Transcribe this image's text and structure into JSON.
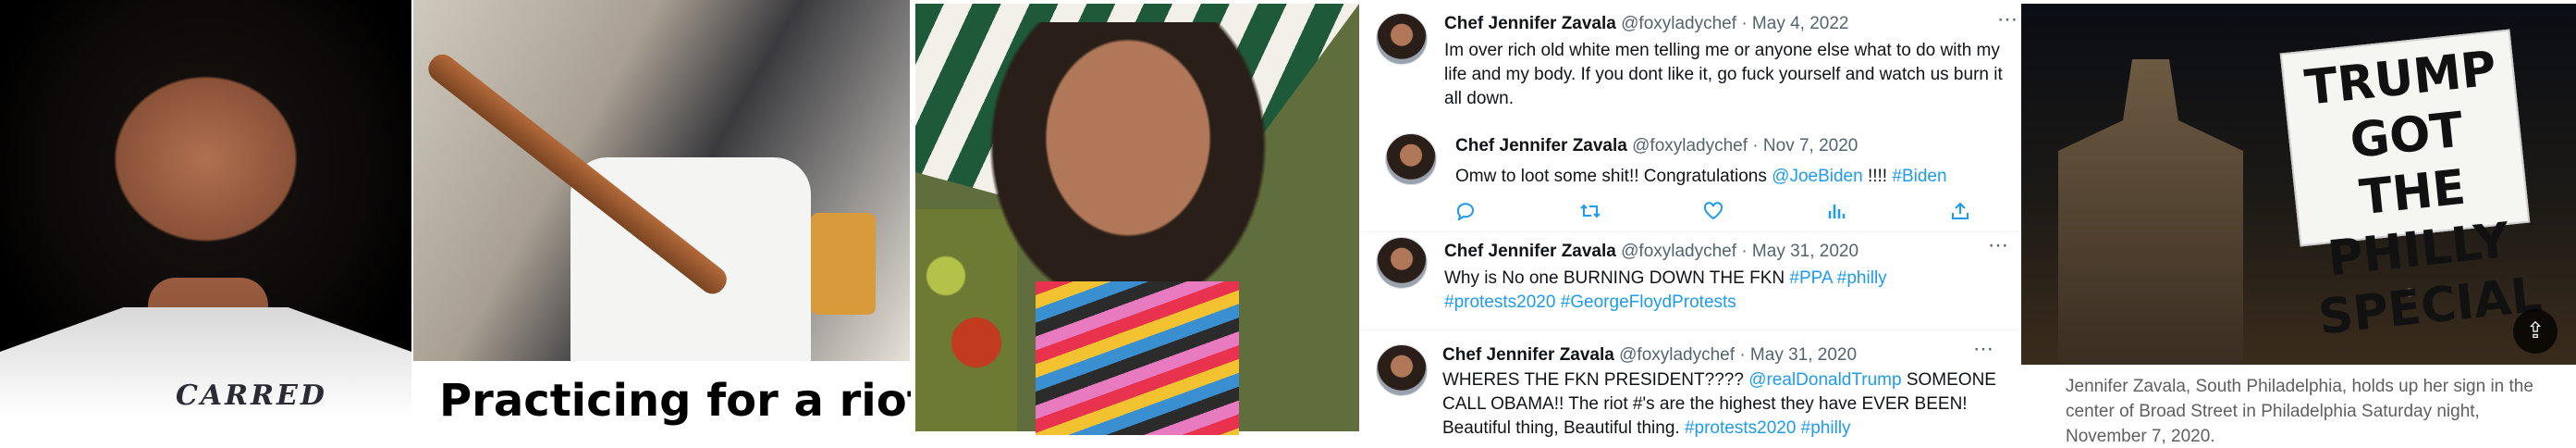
{
  "panel2": {
    "caption": "Practicing for a riot?"
  },
  "panel1": {
    "tattoo_text": "CARRED"
  },
  "tweets": [
    {
      "name": "Chef Jennifer Zavala",
      "handle": "@foxyladychef",
      "date": "· May 4, 2022",
      "text": "Im over rich old white men telling me or anyone else what to do with my life and my body. If you dont like it, go fuck yourself and watch us burn it all down."
    },
    {
      "name": "Chef Jennifer Zavala",
      "handle": "@foxyladychef",
      "date": "· Nov 7, 2020",
      "text_parts": [
        "Omw to loot some shit!! Congratulations ",
        "@JoeBiden",
        " !!!! ",
        "#Biden"
      ],
      "actions": [
        "reply-icon",
        "retweet-icon",
        "like-icon",
        "views-icon",
        "share-icon"
      ]
    },
    {
      "name": "Chef Jennifer Zavala",
      "handle": "@foxyladychef",
      "date": "· May 31, 2020",
      "text_parts": [
        "Why is No one BURNING DOWN THE FKN ",
        "#PPA",
        " ",
        "#philly",
        " ",
        "#protests2020",
        " ",
        "#GeorgeFloydProtests"
      ]
    },
    {
      "name": "Chef Jennifer Zavala",
      "handle": "@foxyladychef",
      "date": "· May 31, 2020",
      "text_parts": [
        "WHERES THE FKN PRESIDENT???? ",
        "@realDonaldTrump",
        " SOMEONE CALL OBAMA!! The riot #'s are the highest they have EVER BEEN! Beautiful thing, Beautiful thing. ",
        "#protests2020",
        " ",
        "#philly"
      ]
    }
  ],
  "panel5": {
    "sign_text": "TRUMP GOT THE PHILLY SPECIAL",
    "caption": "Jennifer Zavala, South Philadelphia, holds up her sign in the center of Broad Street in Philadelphia Saturday night, November 7, 2020."
  },
  "colors": {
    "link": "#1d9bf0",
    "meta": "#536471"
  }
}
